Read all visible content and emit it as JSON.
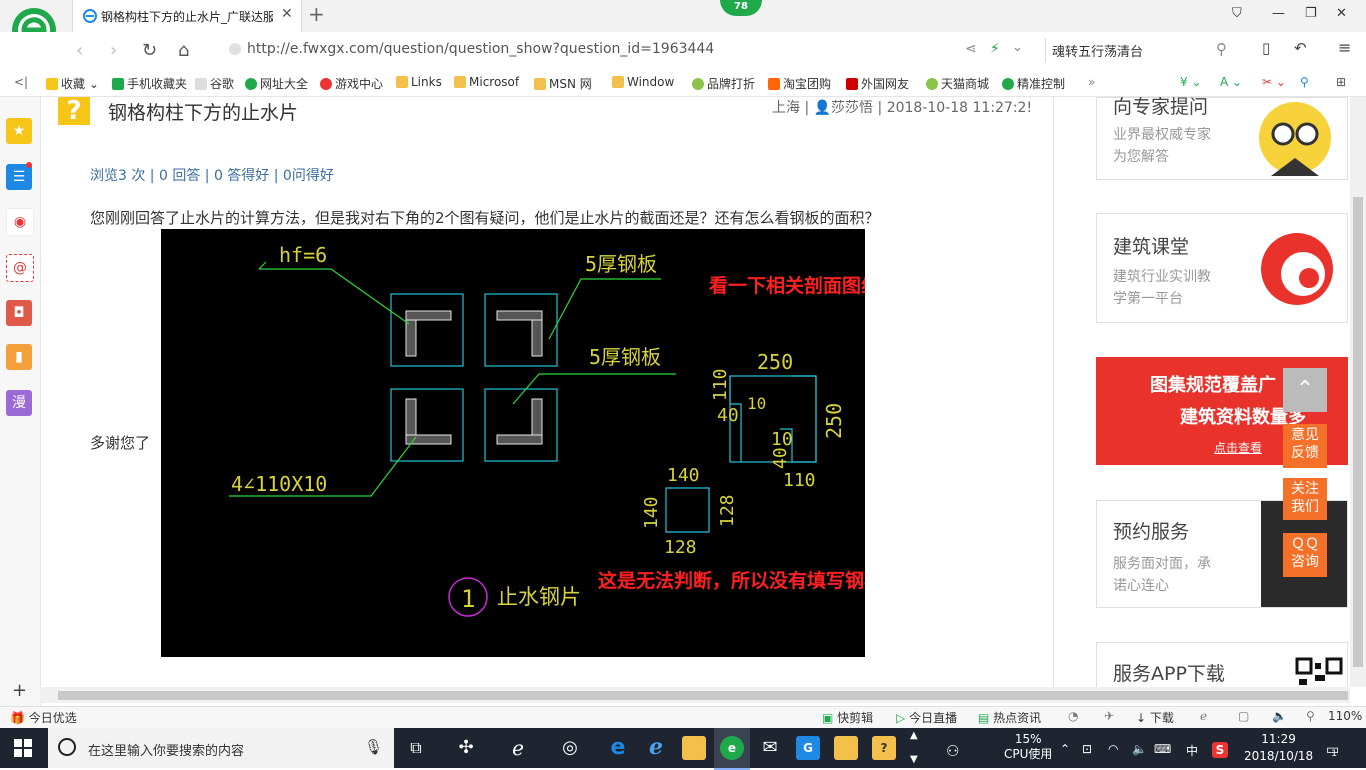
{
  "browser": {
    "tab_title": "钢格构柱下方的止水片_广联达服",
    "badge_count": "78",
    "url": "http://e.fwxgx.com/question/question_show?question_id=1963444",
    "search_text": "魂转五行荡清台",
    "zoom": "110%"
  },
  "bookmarks": [
    "收藏",
    "手机收藏夹",
    "谷歌",
    "网址大全",
    "游戏中心",
    "Links",
    "Microsof",
    "MSN 网",
    "Window",
    "品牌打折",
    "淘宝团购",
    "外国网友",
    "天猫商城",
    "精准控制"
  ],
  "question": {
    "title": "钢格构柱下方的止水片",
    "location": "上海",
    "user": "莎莎悟",
    "time": "2018-10-18 11:27:2!",
    "stats": "浏览3 次 | 0 回答 | 0 答得好 | 0问得好",
    "body": "您刚刚回答了止水片的计算方法，但是我对右下角的2个图有疑问，他们是止水片的截面还是？还有怎么看钢板的面积？",
    "thanks": "多谢您了"
  },
  "cad": {
    "hf": "hf=6",
    "plate1": "5厚钢板",
    "plate2": "5厚钢板",
    "angle": "4∠110X10",
    "note1": "看一下相关剖面图纸",
    "note2": "这是无法判断，所以没有填写钢板的截面面积",
    "d250a": "250",
    "d250b": "250",
    "d110a": "110",
    "d110b": "110",
    "d40a": "40",
    "d40b": "40",
    "d10a": "10",
    "d10b": "10",
    "d140a": "140",
    "d140b": "140",
    "d128a": "128",
    "d128b": "128",
    "circle_num": "1",
    "caption": "止水钢片"
  },
  "right_panels": [
    {
      "title": "向专家提问",
      "sub1": "业界最权威专家",
      "sub2": "为您解答"
    },
    {
      "title": "建筑课堂",
      "sub1": "建筑行业实训教",
      "sub2": "学第一平台"
    },
    {
      "title": "图集规范覆盖广",
      "sub1": "建筑资料数量多",
      "sub2": "点击查看"
    },
    {
      "title": "预约服务",
      "sub1": "服务面对面，承",
      "sub2": "诺心连心"
    },
    {
      "title": "服务APP下载"
    }
  ],
  "float_buttons": {
    "feedback1": "意见",
    "feedback2": "反馈",
    "follow1": "关注",
    "follow2": "我们",
    "qq1": "ＱＱ",
    "qq2": "咨询"
  },
  "statusbar": {
    "left": "今日优选",
    "items": [
      "快剪辑",
      "今日直播",
      "热点资讯",
      "下载"
    ]
  },
  "taskbar": {
    "search_placeholder": "在这里输入你要搜索的内容",
    "cpu_pct": "15%",
    "cpu_label": "CPU使用",
    "ime": "中",
    "time": "11:29",
    "date": "2018/10/18",
    "notif": "1"
  }
}
